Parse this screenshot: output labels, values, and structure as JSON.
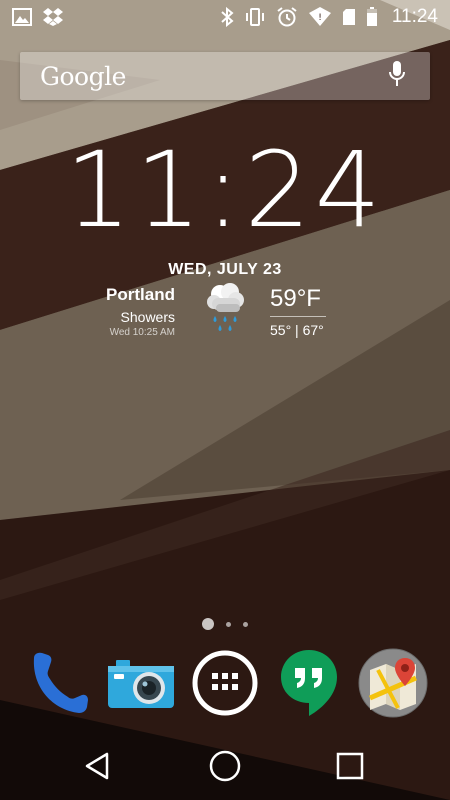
{
  "status_bar": {
    "left_icons": [
      "image-icon",
      "dropbox-icon"
    ],
    "right_icons": [
      "bluetooth-icon",
      "vibrate-icon",
      "alarm-icon",
      "wifi-icon",
      "sd-card-icon",
      "battery-icon"
    ],
    "time": "11:24"
  },
  "search": {
    "logo_text": "Google",
    "mic_icon": "microphone-icon"
  },
  "clock": {
    "time": "11:24"
  },
  "weather": {
    "date": "WED, JULY 23",
    "city": "Portland",
    "condition": "Showers",
    "updated": "Wed 10:25 AM",
    "temperature": "59°F",
    "hi_lo": "55° | 67°",
    "icon": "rain-cloud-icon"
  },
  "home": {
    "page_count": 3,
    "active_page": 0
  },
  "dock": {
    "apps": [
      {
        "name": "Phone",
        "icon": "phone-icon"
      },
      {
        "name": "Camera",
        "icon": "camera-icon"
      },
      {
        "name": "Apps",
        "icon": "app-drawer-icon"
      },
      {
        "name": "Hangouts",
        "icon": "hangouts-icon"
      },
      {
        "name": "Maps",
        "icon": "maps-icon"
      }
    ]
  },
  "nav": {
    "back_icon": "back-icon",
    "home_icon": "home-icon",
    "recents_icon": "recents-icon"
  },
  "colors": {
    "wall_light": "#a39887",
    "wall_dark": "#2a1712",
    "phone_blue": "#2a6fd6",
    "hangouts_green": "#0f9d58"
  }
}
